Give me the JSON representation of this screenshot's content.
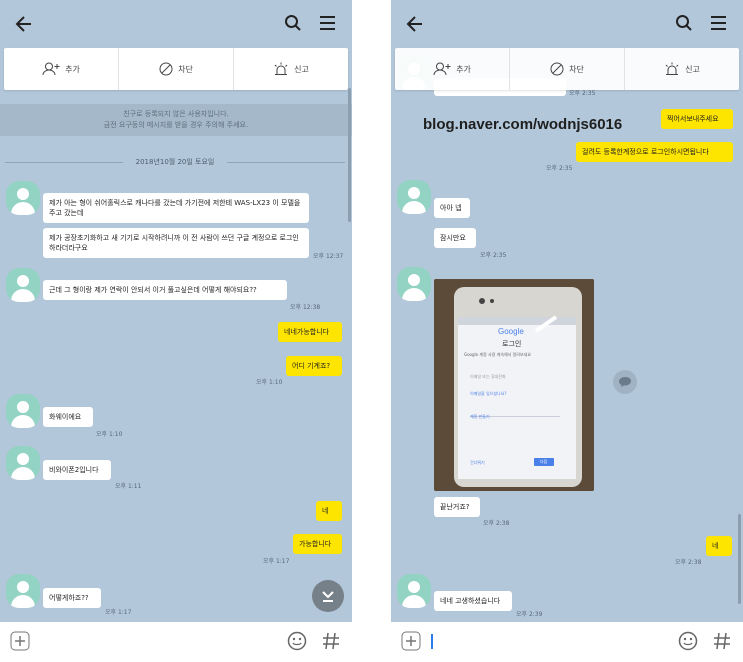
{
  "left": {
    "menu": {
      "add_label": "추가",
      "block_label": "차단",
      "report_label": "신고"
    },
    "notice": {
      "line1": "친구로 등록되지 않은 사용자입니다.",
      "line2": "금전 요구등의 메시지를 받을 경우 주의해 주세요."
    },
    "date_separator": "2018년10월 20일 토요일",
    "messages": [
      {
        "text": "제가 아는 형이 쉬어홀릭스로 캐나다를 갔는데 가기전에 저한테 WAS-LX23 이 모델을 주고 갔는데"
      },
      {
        "text": "제가 공장초기화하고 새 기기로 시작하려니까 이 전 사람이 쓰던 구글 계정으로 로그인하라더라구요",
        "time": "오후 12:37"
      },
      {
        "text": "근데 그 형이랑 제가 연락이 안되서 이거 풀고싶은데 어떻게 해야되요??",
        "time": "오후 12:38"
      },
      {
        "text": "네네가능합니다"
      },
      {
        "text": "어디 기계죠?",
        "time": "오후 1:10"
      },
      {
        "text": "화웨이에요",
        "time": "오후 1:10"
      },
      {
        "text": "비와이폰2입니다",
        "time": "오후 1:11"
      },
      {
        "text": "네"
      },
      {
        "text": "가능합니다",
        "time": "오후 1:17"
      },
      {
        "text": "어떻게하죠??",
        "time": "오후 1:17"
      }
    ]
  },
  "right": {
    "menu": {
      "add_label": "추가",
      "block_label": "차단",
      "report_label": "신고"
    },
    "watermark": "blog.naver.com/wodnjs6016",
    "top_time": "오후 2:35",
    "messages": [
      {
        "text": "찍어서보내주세요"
      },
      {
        "text": "걸려도 등록한계정으로 로그인하시면됩니다",
        "time": "오후 2:35"
      },
      {
        "text": "아아 넵"
      },
      {
        "text": "잠시만요",
        "time": "오후 2:35"
      },
      {
        "text": "끝난거죠?",
        "time": "오후 2:38"
      },
      {
        "text": "네",
        "time": "오후 2:38"
      },
      {
        "text": "네네 고생하셨습니다",
        "time": "오후 2:39"
      }
    ],
    "photo_screen": {
      "logo": "Google",
      "title": "로그인",
      "subtitle": "Google 계정 사용 계속해서 알려보세요",
      "email_hint": "이메일 또는 휴대전화",
      "forgot": "이메일을 잊으셨나요?",
      "create": "계정 만들기",
      "prev": "건너뛰기",
      "next": "다음"
    }
  },
  "icons": {
    "back": "back-arrow-icon",
    "search": "search-icon",
    "menu": "hamburger-menu-icon",
    "add_friend": "add-friend-icon",
    "block": "block-icon",
    "report": "report-siren-icon",
    "plus": "plus-icon",
    "emoji": "emoji-icon",
    "hash": "hash-icon",
    "scroll_down": "scroll-down-icon",
    "share": "share-icon"
  },
  "colors": {
    "chat_bg": "#b2c7d9",
    "my_bubble": "#fee500",
    "other_bubble": "#ffffff",
    "avatar": "#93d3c4"
  }
}
